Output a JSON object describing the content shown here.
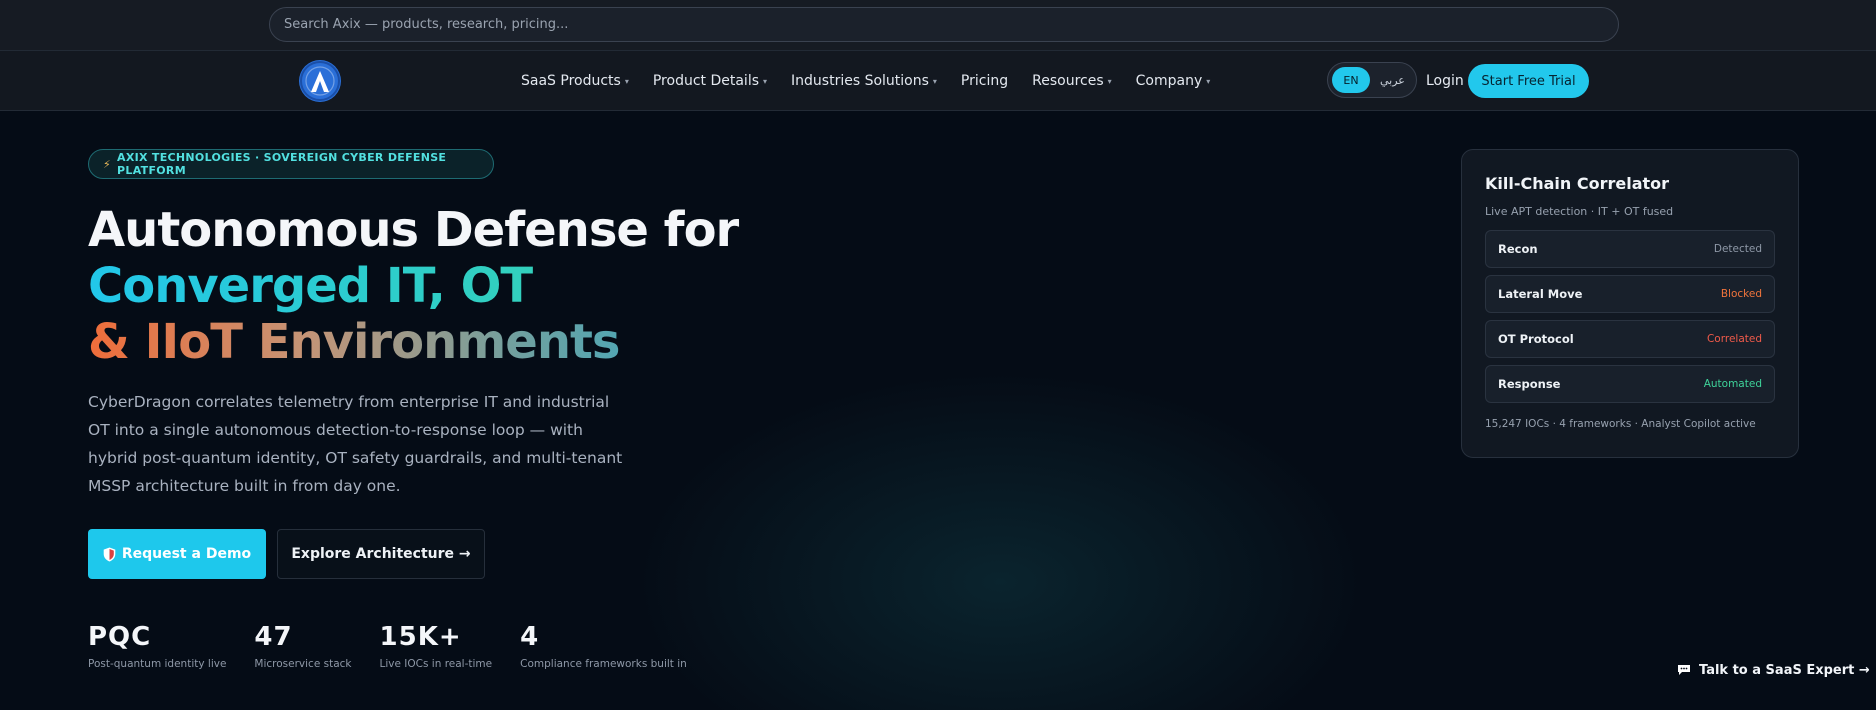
{
  "search": {
    "placeholder": "Search Axix — products, research, pricing..."
  },
  "nav": {
    "items": [
      {
        "label": "SaaS Products",
        "caret": "▾"
      },
      {
        "label": "Product Details",
        "caret": "▾"
      },
      {
        "label": "Industries Solutions",
        "caret": "▾"
      },
      {
        "label": "Pricing",
        "caret": ""
      },
      {
        "label": "Resources",
        "caret": "▾"
      },
      {
        "label": "Company",
        "caret": "▾"
      }
    ],
    "lang_en": "EN",
    "lang_ar": "عربي",
    "login": "Login",
    "trial": "Start Free Trial"
  },
  "hero": {
    "badge": "AXIX TECHNOLOGIES · SOVEREIGN CYBER DEFENSE PLATFORM",
    "badge_icon": "⚡",
    "headline_1": "Autonomous Defense for",
    "headline_2": "Converged IT, OT",
    "headline_3": "& IIoT Environments",
    "description": "CyberDragon correlates telemetry from enterprise IT and industrial OT into a single autonomous detection-to-response loop — with hybrid post-quantum identity, OT safety guardrails, and multi-tenant MSSP architecture built in from day one.",
    "demo_button": "Request a Demo",
    "arch_button": "Explore Architecture →"
  },
  "stats": [
    {
      "value": "PQC",
      "label": "Post-quantum identity live"
    },
    {
      "value": "47",
      "label": "Microservice stack"
    },
    {
      "value": "15K+",
      "label": "Live IOCs in real-time"
    },
    {
      "value": "4",
      "label": "Compliance frameworks built in"
    }
  ],
  "card": {
    "title": "Kill-Chain Correlator",
    "subtitle": "Live APT detection · IT + OT fused",
    "rows": [
      {
        "label": "Recon",
        "status": "Detected",
        "color": "#8e98a7"
      },
      {
        "label": "Lateral Move",
        "status": "Blocked",
        "color": "#f0743c"
      },
      {
        "label": "OT Protocol",
        "status": "Correlated",
        "color": "#f05a4a"
      },
      {
        "label": "Response",
        "status": "Automated",
        "color": "#3ed39a"
      }
    ],
    "footer": "15,247 IOCs · 4 frameworks · Analyst Copilot active"
  },
  "expert": {
    "label": "Talk to a SaaS Expert →"
  },
  "colors": {
    "accent": "#22c8ec",
    "background": "#050c16"
  }
}
